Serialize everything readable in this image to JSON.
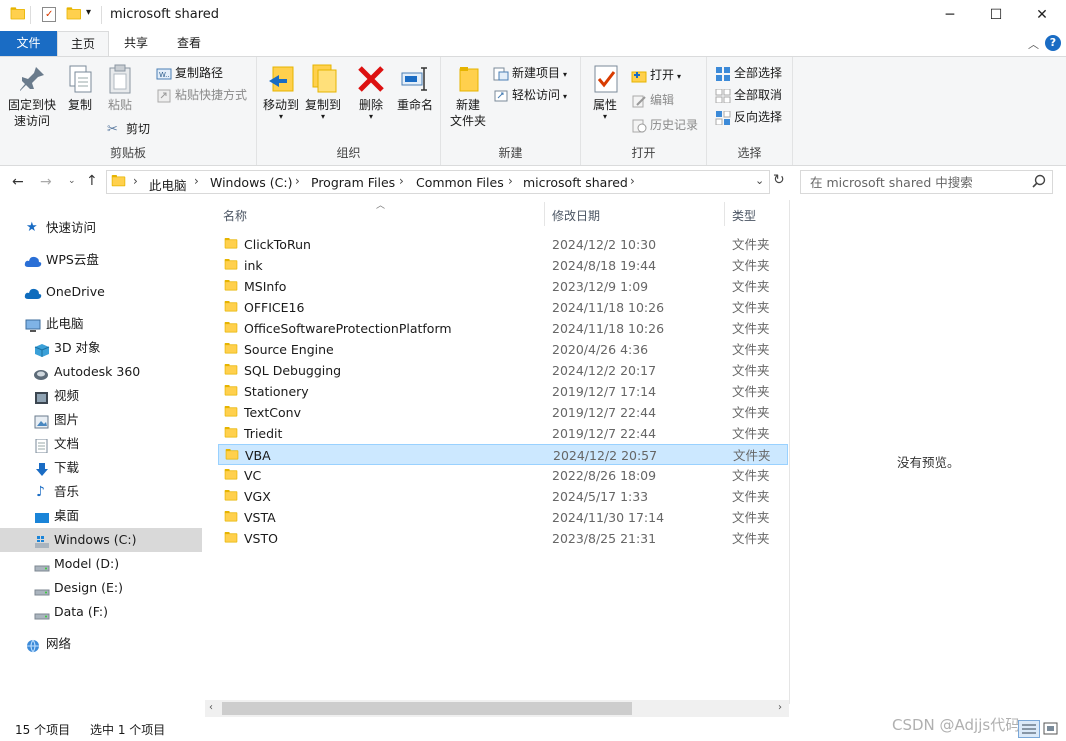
{
  "window": {
    "title": "microsoft shared",
    "controls": {
      "minimize": "─",
      "maximize": "☐",
      "close": "✕"
    }
  },
  "ribbon_tabs": [
    "文件",
    "主页",
    "共享",
    "查看"
  ],
  "ribbon": {
    "clipboard": {
      "label": "剪贴板",
      "pin": "固定到快速访问",
      "pin_line1": "固定到快",
      "pin_line2": "速访问",
      "copy": "复制",
      "paste": "粘贴",
      "copy_path": "复制路径",
      "paste_shortcut": "粘贴快捷方式",
      "cut": "剪切"
    },
    "organize": {
      "label": "组织",
      "move_to": "移动到",
      "copy_to": "复制到",
      "delete": "删除",
      "rename": "重命名"
    },
    "new": {
      "label": "新建",
      "new_folder_line1": "新建",
      "new_folder_line2": "文件夹",
      "new_item": "新建项目",
      "easy_access": "轻松访问"
    },
    "open": {
      "label": "打开",
      "properties": "属性",
      "open": "打开",
      "edit": "编辑",
      "history": "历史记录"
    },
    "select": {
      "label": "选择",
      "select_all": "全部选择",
      "select_none": "全部取消",
      "invert": "反向选择"
    }
  },
  "address": {
    "crumbs": [
      "此电脑",
      "Windows (C:)",
      "Program Files",
      "Common Files",
      "microsoft shared"
    ]
  },
  "search": {
    "placeholder": "在 microsoft shared 中搜索"
  },
  "nav": {
    "quick_access": "快速访问",
    "wps": "WPS云盘",
    "onedrive": "OneDrive",
    "this_pc": "此电脑",
    "items": [
      "3D 对象",
      "Autodesk 360",
      "视频",
      "图片",
      "文档",
      "下载",
      "音乐",
      "桌面",
      "Windows (C:)",
      "Model (D:)",
      "Design (E:)",
      "Data (F:)"
    ],
    "network": "网络"
  },
  "columns": {
    "name": "名称",
    "date": "修改日期",
    "type": "类型"
  },
  "files": [
    {
      "name": "ClickToRun",
      "date": "2024/12/2 10:30",
      "type": "文件夹"
    },
    {
      "name": "ink",
      "date": "2024/8/18 19:44",
      "type": "文件夹"
    },
    {
      "name": "MSInfo",
      "date": "2023/12/9 1:09",
      "type": "文件夹"
    },
    {
      "name": "OFFICE16",
      "date": "2024/11/18 10:26",
      "type": "文件夹"
    },
    {
      "name": "OfficeSoftwareProtectionPlatform",
      "date": "2024/11/18 10:26",
      "type": "文件夹"
    },
    {
      "name": "Source Engine",
      "date": "2020/4/26 4:36",
      "type": "文件夹"
    },
    {
      "name": "SQL Debugging",
      "date": "2024/12/2 20:17",
      "type": "文件夹"
    },
    {
      "name": "Stationery",
      "date": "2019/12/7 17:14",
      "type": "文件夹"
    },
    {
      "name": "TextConv",
      "date": "2019/12/7 22:44",
      "type": "文件夹"
    },
    {
      "name": "Triedit",
      "date": "2019/12/7 22:44",
      "type": "文件夹"
    },
    {
      "name": "VBA",
      "date": "2024/12/2 20:57",
      "type": "文件夹"
    },
    {
      "name": "VC",
      "date": "2022/8/26 18:09",
      "type": "文件夹"
    },
    {
      "name": "VGX",
      "date": "2024/5/17 1:33",
      "type": "文件夹"
    },
    {
      "name": "VSTA",
      "date": "2024/11/30 17:14",
      "type": "文件夹"
    },
    {
      "name": "VSTO",
      "date": "2023/8/25 21:31",
      "type": "文件夹"
    }
  ],
  "preview": {
    "empty": "没有预览。"
  },
  "status": {
    "count": "15 个项目",
    "selected": "选中 1 个项目"
  },
  "watermark": "CSDN @Adjjs代码",
  "colors": {
    "accent": "#1a6cc4",
    "selection": "#cce8ff",
    "folder": "#ffd04d"
  }
}
